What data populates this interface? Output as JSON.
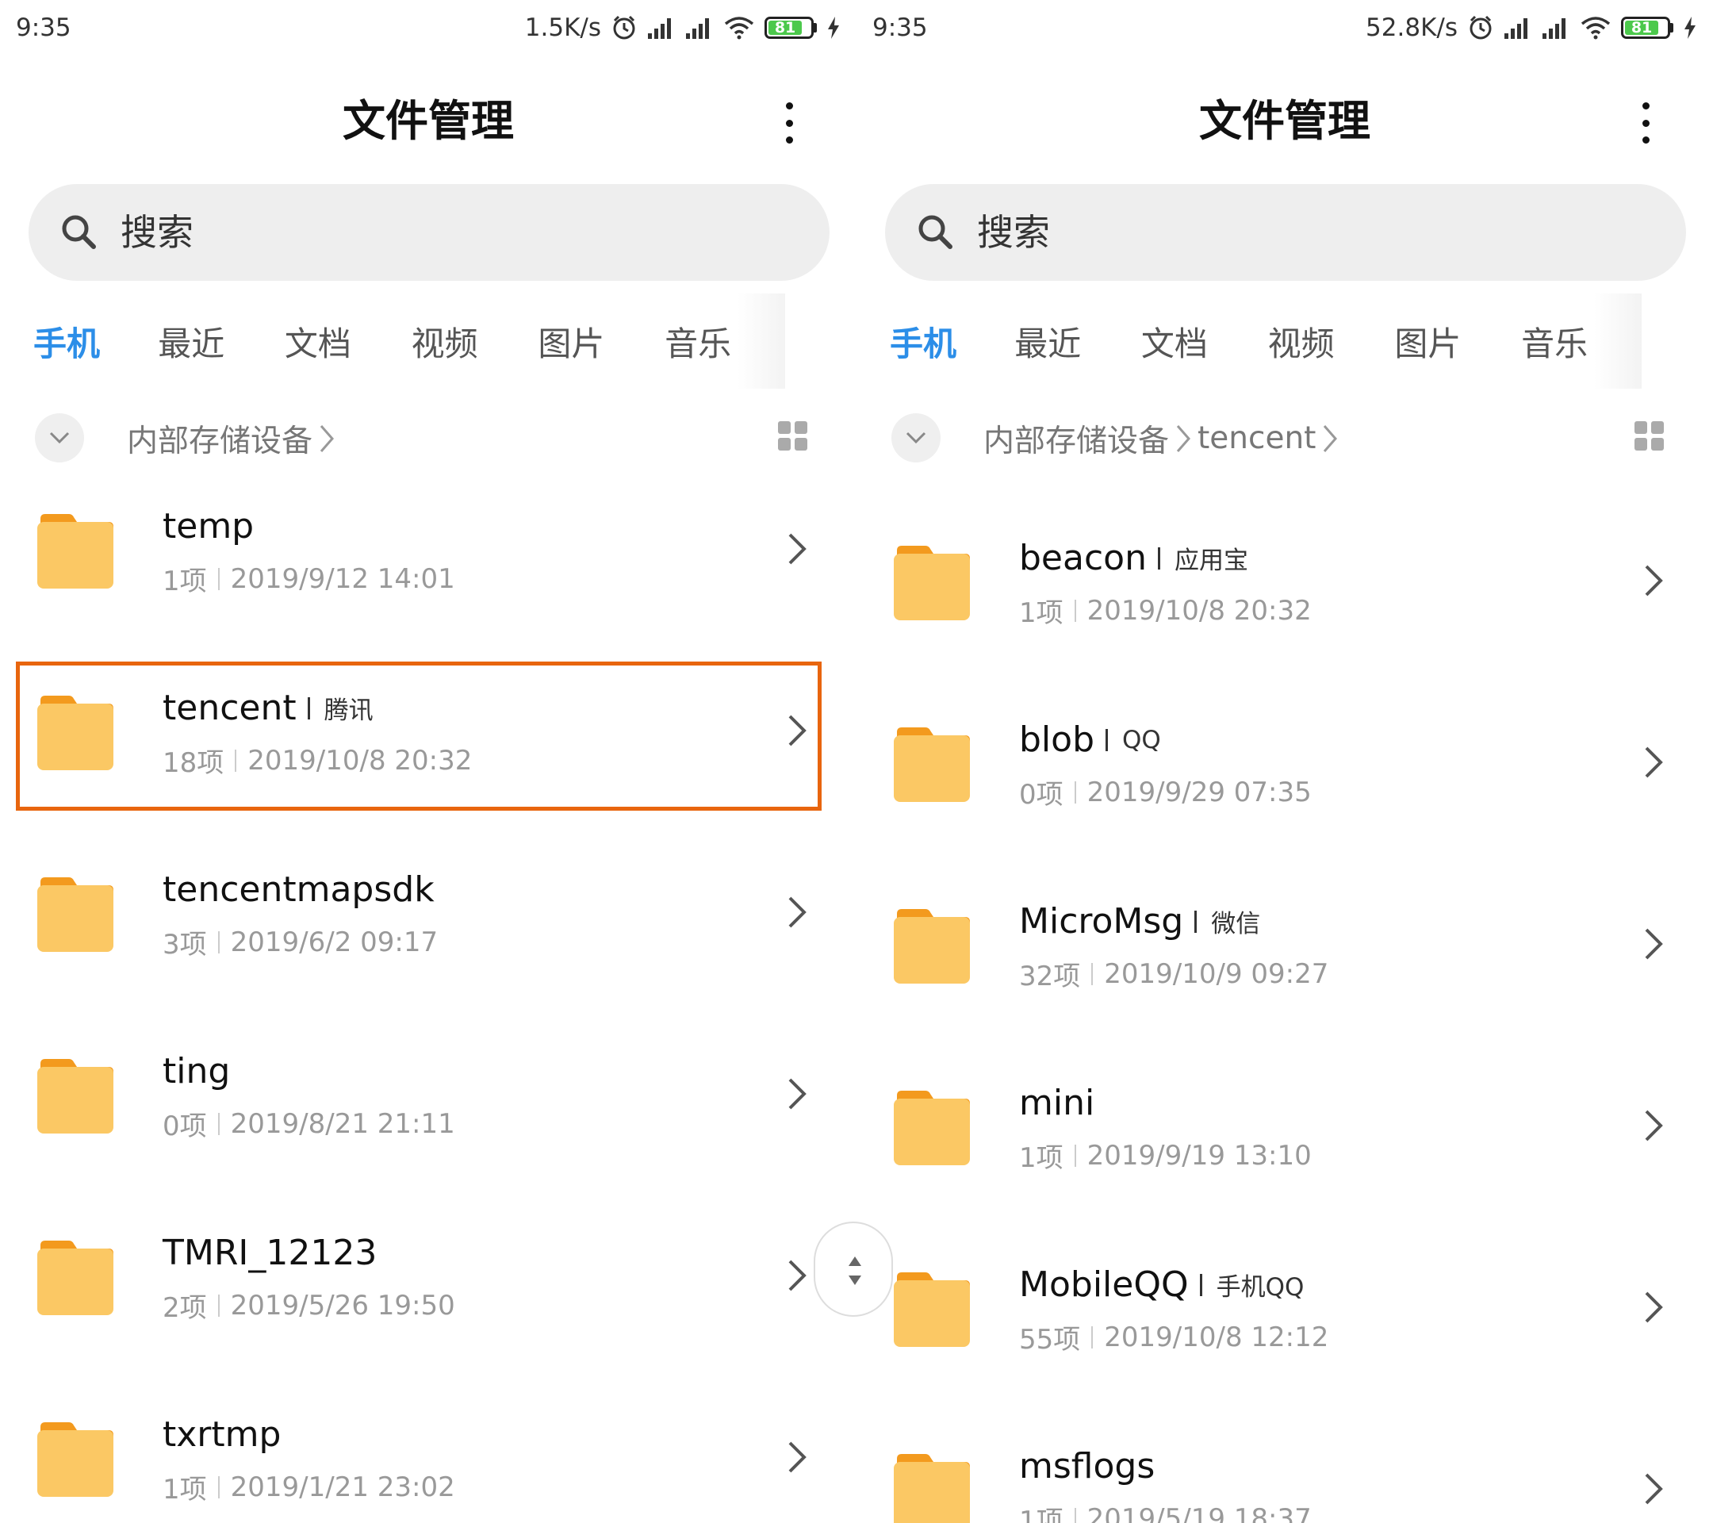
{
  "accent_color": "#2c8ee8",
  "highlight_color": "#e8650e",
  "folder_color": "#fbc864",
  "screens": [
    {
      "status": {
        "time": "9:35",
        "net_speed": "1.5K/s",
        "battery": "81",
        "battery_level": 0.81
      },
      "header": {
        "title": "文件管理"
      },
      "search": {
        "placeholder": "搜索"
      },
      "tabs": [
        "手机",
        "最近",
        "文档",
        "视频",
        "图片",
        "音乐"
      ],
      "active_tab": 0,
      "breadcrumb": [
        "内部存储设备"
      ],
      "files": [
        {
          "name": "temp",
          "tag": "",
          "count": "1项",
          "date": "2019/9/12 14:01"
        },
        {
          "name": "tencent",
          "tag": "腾讯",
          "count": "18项",
          "date": "2019/10/8 20:32",
          "highlighted": true
        },
        {
          "name": "tencentmapsdk",
          "tag": "",
          "count": "3项",
          "date": "2019/6/2 09:17"
        },
        {
          "name": "ting",
          "tag": "",
          "count": "0项",
          "date": "2019/8/21 21:11"
        },
        {
          "name": "TMRI_12123",
          "tag": "",
          "count": "2项",
          "date": "2019/5/26 19:50"
        },
        {
          "name": "txrtmp",
          "tag": "",
          "count": "1项",
          "date": "2019/1/21 23:02"
        }
      ]
    },
    {
      "status": {
        "time": "9:35",
        "net_speed": "52.8K/s",
        "battery": "81",
        "battery_level": 0.81
      },
      "header": {
        "title": "文件管理"
      },
      "search": {
        "placeholder": "搜索"
      },
      "tabs": [
        "手机",
        "最近",
        "文档",
        "视频",
        "图片",
        "音乐"
      ],
      "active_tab": 0,
      "breadcrumb": [
        "内部存储设备",
        "tencent"
      ],
      "files": [
        {
          "name": "beacon",
          "tag": "应用宝",
          "count": "1项",
          "date": "2019/10/8 20:32"
        },
        {
          "name": "blob",
          "tag": "QQ",
          "count": "0项",
          "date": "2019/9/29 07:35"
        },
        {
          "name": "MicroMsg",
          "tag": "微信",
          "count": "32项",
          "date": "2019/10/9 09:27"
        },
        {
          "name": "mini",
          "tag": "",
          "count": "1项",
          "date": "2019/9/19 13:10"
        },
        {
          "name": "MobileQQ",
          "tag": "手机QQ",
          "count": "55项",
          "date": "2019/10/8 12:12"
        },
        {
          "name": "msflogs",
          "tag": "",
          "count": "1项",
          "date": "2019/5/19 18:37"
        }
      ]
    }
  ]
}
